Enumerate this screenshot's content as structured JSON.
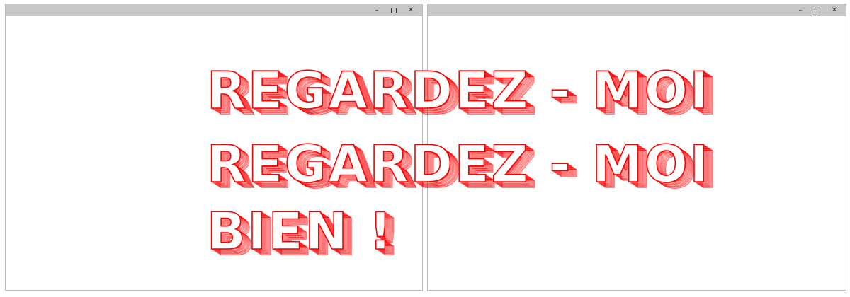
{
  "windows": [
    {
      "id": "left",
      "controls": {
        "minimize": "minimize-icon",
        "maximize": "maximize-icon",
        "close": "close-icon"
      }
    },
    {
      "id": "right",
      "controls": {
        "minimize": "minimize-icon",
        "maximize": "maximize-icon",
        "close": "close-icon"
      }
    }
  ],
  "text_lines": [
    {
      "text": "REGARDEZ - MOI"
    },
    {
      "text": "REGARDEZ - MOI"
    },
    {
      "text": "BIEN !"
    }
  ],
  "colors": {
    "text_stroke": "#ff0000",
    "text_fill": "#ffffff",
    "titlebar": "#c8c8c8",
    "window_border": "#b8b8b8"
  }
}
